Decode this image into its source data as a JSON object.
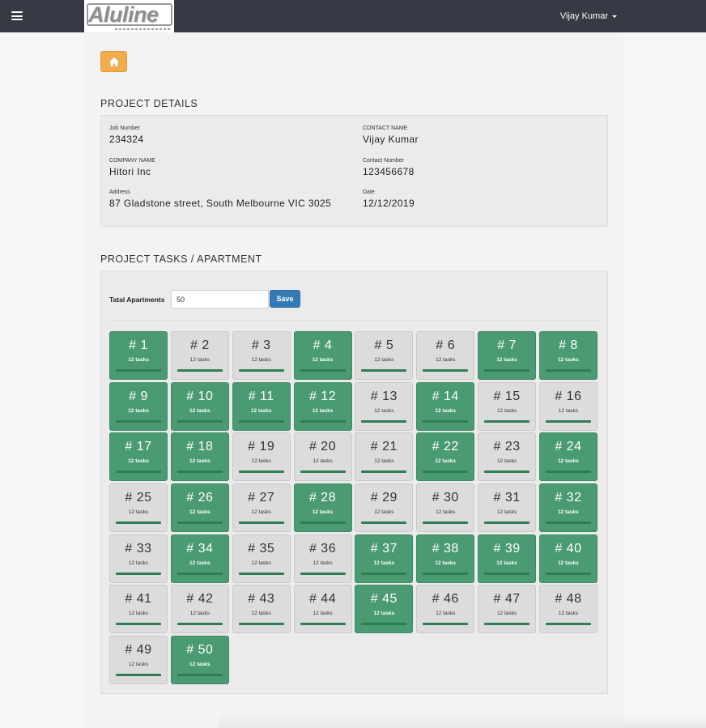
{
  "header": {
    "logo_text": "Aluline",
    "user_name": "Vijay Kumar",
    "icons": {
      "menu": "hamburger-icon",
      "home": "home-icon",
      "user_caret": "caret-down-icon"
    },
    "colors": {
      "topbar": "#363a45",
      "home_button": "#f0ad4e",
      "save_button": "#337ab7",
      "tile_done": "#4a9a72",
      "tile_pending": "#dcdcdc",
      "progress": "#2f7d52"
    }
  },
  "project_details": {
    "title": "PROJECT DETAILS",
    "job_number": {
      "label": "Job Number",
      "value": "234324"
    },
    "contact_name": {
      "label": "CONTACT NAME",
      "value": "Vijay Kumar"
    },
    "company_name": {
      "label": "COMPANY NAME",
      "value": "Hitori Inc"
    },
    "contact_number": {
      "label": "Contact Number",
      "value": "123456678"
    },
    "address": {
      "label": "Address",
      "value": "87 Gladstone street, South Melbourne VIC 3025"
    },
    "date": {
      "label": "Date",
      "value": "12/12/2019"
    }
  },
  "project_tasks": {
    "title": "PROJECT TASKS / APARTMENT",
    "total_label": "Tatal Apartments",
    "total_value": "50",
    "save_label": "Save",
    "apartments": [
      {
        "label": "# 1",
        "tasks": "12 tasks",
        "done": true,
        "progress": 1
      },
      {
        "label": "# 2",
        "tasks": "12 tasks",
        "done": false,
        "progress": 1
      },
      {
        "label": "# 3",
        "tasks": "12 tasks",
        "done": false,
        "progress": 1
      },
      {
        "label": "# 4",
        "tasks": "12 tasks",
        "done": true,
        "progress": 1
      },
      {
        "label": "# 5",
        "tasks": "12 tasks",
        "done": false,
        "progress": 1
      },
      {
        "label": "# 6",
        "tasks": "12 tasks",
        "done": false,
        "progress": 1
      },
      {
        "label": "# 7",
        "tasks": "12 tasks",
        "done": true,
        "progress": 1
      },
      {
        "label": "# 8",
        "tasks": "12 tasks",
        "done": true,
        "progress": 1
      },
      {
        "label": "# 9",
        "tasks": "12 tasks",
        "done": true,
        "progress": 1
      },
      {
        "label": "# 10",
        "tasks": "12 tasks",
        "done": true,
        "progress": 1
      },
      {
        "label": "# 11",
        "tasks": "12 tasks",
        "done": true,
        "progress": 1
      },
      {
        "label": "# 12",
        "tasks": "12 tasks",
        "done": true,
        "progress": 1
      },
      {
        "label": "# 13",
        "tasks": "12 tasks",
        "done": false,
        "progress": 1
      },
      {
        "label": "# 14",
        "tasks": "12 tasks",
        "done": true,
        "progress": 1
      },
      {
        "label": "# 15",
        "tasks": "12 tasks",
        "done": false,
        "progress": 1
      },
      {
        "label": "# 16",
        "tasks": "12 tasks",
        "done": false,
        "progress": 1
      },
      {
        "label": "# 17",
        "tasks": "12 tasks",
        "done": true,
        "progress": 1
      },
      {
        "label": "# 18",
        "tasks": "12 tasks",
        "done": true,
        "progress": 1
      },
      {
        "label": "# 19",
        "tasks": "12 tasks",
        "done": false,
        "progress": 1
      },
      {
        "label": "# 20",
        "tasks": "12 tasks",
        "done": false,
        "progress": 1
      },
      {
        "label": "# 21",
        "tasks": "12 tasks",
        "done": false,
        "progress": 1
      },
      {
        "label": "# 22",
        "tasks": "12 tasks",
        "done": true,
        "progress": 1
      },
      {
        "label": "# 23",
        "tasks": "12 tasks",
        "done": false,
        "progress": 1
      },
      {
        "label": "# 24",
        "tasks": "12 tasks",
        "done": true,
        "progress": 1
      },
      {
        "label": "# 25",
        "tasks": "12 tasks",
        "done": false,
        "progress": 1
      },
      {
        "label": "# 26",
        "tasks": "12 tasks",
        "done": true,
        "progress": 1
      },
      {
        "label": "# 27",
        "tasks": "12 tasks",
        "done": false,
        "progress": 1
      },
      {
        "label": "# 28",
        "tasks": "12 tasks",
        "done": true,
        "progress": 1
      },
      {
        "label": "# 29",
        "tasks": "12 tasks",
        "done": false,
        "progress": 1
      },
      {
        "label": "# 30",
        "tasks": "12 tasks",
        "done": false,
        "progress": 1
      },
      {
        "label": "# 31",
        "tasks": "12 tasks",
        "done": false,
        "progress": 1
      },
      {
        "label": "# 32",
        "tasks": "12 tasks",
        "done": true,
        "progress": 1
      },
      {
        "label": "# 33",
        "tasks": "12 tasks",
        "done": false,
        "progress": 1
      },
      {
        "label": "# 34",
        "tasks": "12 tasks",
        "done": true,
        "progress": 1
      },
      {
        "label": "# 35",
        "tasks": "12 tasks",
        "done": false,
        "progress": 1
      },
      {
        "label": "# 36",
        "tasks": "12 tasks",
        "done": false,
        "progress": 1
      },
      {
        "label": "# 37",
        "tasks": "12 tasks",
        "done": true,
        "progress": 1
      },
      {
        "label": "# 38",
        "tasks": "12 tasks",
        "done": true,
        "progress": 1
      },
      {
        "label": "# 39",
        "tasks": "12 tasks",
        "done": true,
        "progress": 1
      },
      {
        "label": "# 40",
        "tasks": "12 tasks",
        "done": true,
        "progress": 1
      },
      {
        "label": "# 41",
        "tasks": "12 tasks",
        "done": false,
        "progress": 1
      },
      {
        "label": "# 42",
        "tasks": "12 tasks",
        "done": false,
        "progress": 1
      },
      {
        "label": "# 43",
        "tasks": "12 tasks",
        "done": false,
        "progress": 1
      },
      {
        "label": "# 44",
        "tasks": "12 tasks",
        "done": false,
        "progress": 1
      },
      {
        "label": "# 45",
        "tasks": "12 tasks",
        "done": true,
        "progress": 1
      },
      {
        "label": "# 46",
        "tasks": "12 tasks",
        "done": false,
        "progress": 1
      },
      {
        "label": "# 47",
        "tasks": "12 tasks",
        "done": false,
        "progress": 1
      },
      {
        "label": "# 48",
        "tasks": "12 tasks",
        "done": false,
        "progress": 1
      },
      {
        "label": "# 49",
        "tasks": "12 tasks",
        "done": false,
        "progress": 1
      },
      {
        "label": "# 50",
        "tasks": "12 tasks",
        "done": true,
        "progress": 1
      }
    ]
  }
}
